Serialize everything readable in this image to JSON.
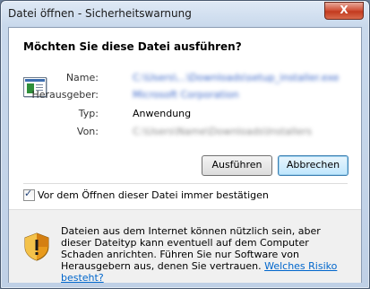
{
  "window": {
    "title": "Datei öffnen - Sicherheitswarnung",
    "close_glyph": "X"
  },
  "heading": "Möchten Sie diese Datei ausführen?",
  "details": {
    "name_label": "Name:",
    "name_value": "C:\\Users\\...\\Downloads\\setup_installer.exe",
    "publisher_label": "Herausgeber:",
    "publisher_value": "Microsoft Corporation",
    "type_label": "Typ:",
    "type_value": "Anwendung",
    "from_label": "Von:",
    "from_value": "C:\\Users\\Name\\Downloads\\Installers"
  },
  "buttons": {
    "run": "Ausführen",
    "cancel": "Abbrechen"
  },
  "checkbox": {
    "label": "Vor dem Öffnen dieser Datei immer bestätigen",
    "checked": true
  },
  "warning": {
    "text": "Dateien aus dem Internet können nützlich sein, aber dieser Dateityp kann eventuell auf dem Computer Schaden anrichten. Führen Sie nur Software von Herausgebern aus, denen Sie vertrauen.",
    "link": "Welches Risiko besteht?"
  },
  "icons": {
    "file": "application-icon",
    "shield": "security-shield-icon",
    "close": "close-icon"
  }
}
